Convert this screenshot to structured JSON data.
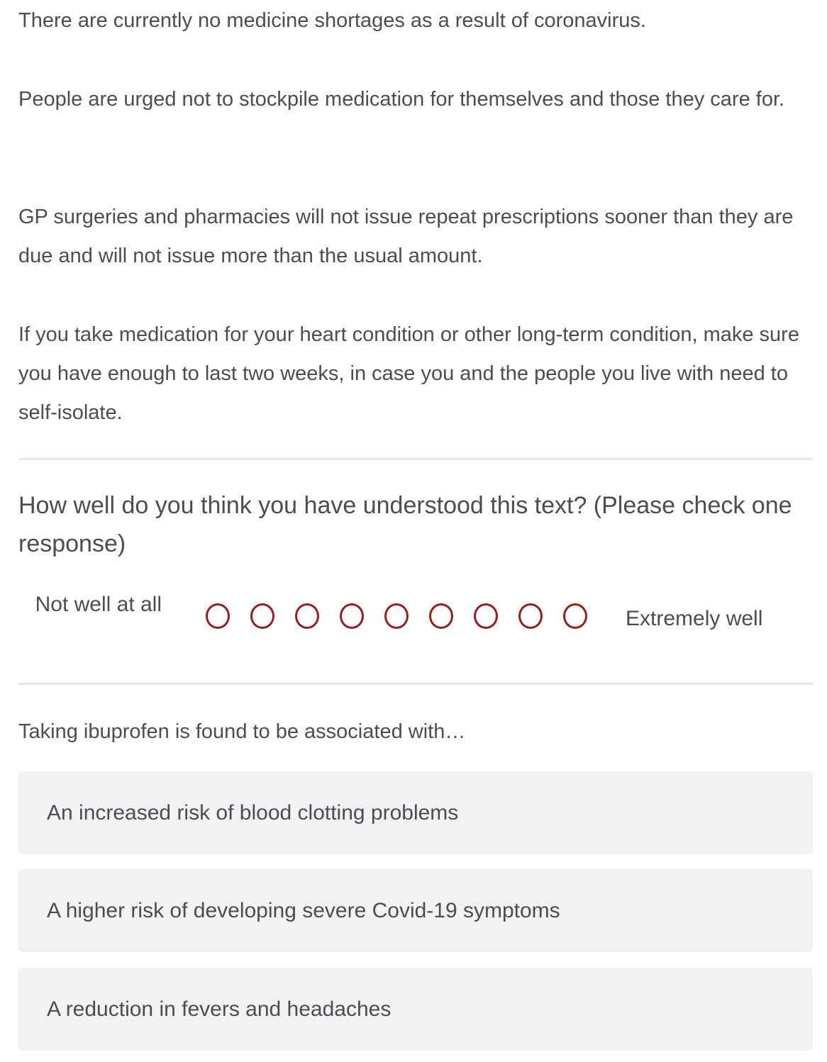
{
  "paragraphs": [
    "There are currently no medicine shortages as a result of coronavirus.",
    "People are urged not to stockpile medication for themselves and those they care for.",
    "GP surgeries and pharmacies will not issue repeat prescriptions sooner than they are due and will not issue more than the usual amount.",
    "If you take medication for your heart condition or other long-term condition, make sure you have enough to last two weeks, in case you and the people you live with need to self-isolate."
  ],
  "rating_question": {
    "text": "How well do you think you have understood this text? (Please check one response)",
    "left_label": "Not well at all",
    "right_label": "Extremely well",
    "points": 9,
    "accent_color": "#9b1c1f"
  },
  "mc_question": {
    "prompt": "Taking ibuprofen is found to be associated with…",
    "options": [
      "An increased risk of blood clotting problems",
      "A higher risk of developing severe Covid-19 symptoms",
      "A reduction in fevers and headaches"
    ]
  }
}
